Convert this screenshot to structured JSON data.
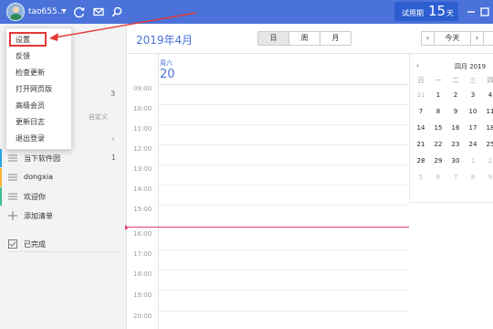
{
  "header": {
    "username": "tao655...",
    "trial": {
      "label": "试用期",
      "days": "15",
      "unit": "天"
    },
    "icons": [
      "sync-icon",
      "mail-icon",
      "search-icon"
    ],
    "colors": {
      "bar": "#4a72d9",
      "trial_bg": "#2d5ed0"
    }
  },
  "menu": {
    "items": [
      "设置",
      "反馈",
      "检查更新",
      "打开网页版",
      "高级会员",
      "更新日志",
      "退出登录"
    ],
    "highlight_color": "#e53935"
  },
  "sidebar": {
    "count_top": "3",
    "custom_label": "自定义",
    "lists": [
      {
        "label": "当下软件园",
        "count": "1",
        "color": "#2aa6e0"
      },
      {
        "label": "dongxia",
        "count": "",
        "color": "#f5b32e"
      },
      {
        "label": "欢迎你",
        "count": "",
        "color": "#3fbf8f"
      }
    ],
    "add_list": "添加清单",
    "completed": "已完成"
  },
  "calendar": {
    "month_title": "2019年4月",
    "views": [
      "日",
      "周",
      "月"
    ],
    "active_view": "日",
    "today_btn": "今天",
    "day": {
      "weekday": "周六",
      "date": "20"
    },
    "hours": [
      "09:00",
      "10:00",
      "11:00",
      "12:00",
      "13:00",
      "14:00",
      "15:00",
      "16:00",
      "17:00",
      "18:00",
      "19:00",
      "20:00"
    ],
    "now_color": "#e0457b"
  },
  "mini_calendar": {
    "title": "四月 2019",
    "weekdays": [
      "日",
      "一",
      "二",
      "三",
      "四"
    ],
    "weeks": [
      [
        "31",
        "1",
        "2",
        "3",
        "4"
      ],
      [
        "7",
        "8",
        "9",
        "10",
        "11"
      ],
      [
        "14",
        "15",
        "16",
        "17",
        "18"
      ],
      [
        "21",
        "22",
        "23",
        "24",
        "25"
      ],
      [
        "28",
        "29",
        "30",
        "1",
        "2"
      ],
      [
        "5",
        "6",
        "7",
        "8",
        "9"
      ]
    ]
  }
}
